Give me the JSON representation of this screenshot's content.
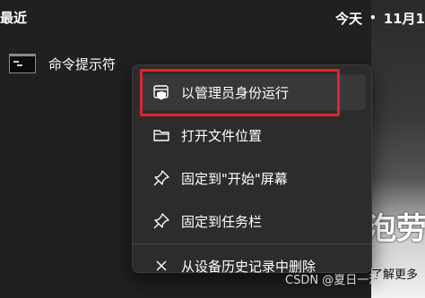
{
  "section": {
    "title": "最近"
  },
  "recent": [
    {
      "label": "命令提示符",
      "icon": "command-prompt-icon"
    }
  ],
  "header": {
    "date_prefix": "今天",
    "separator": "•",
    "date": "11月1"
  },
  "background": {
    "big_text": "泡劳征",
    "small_text": "了解更多"
  },
  "menu": {
    "items": [
      {
        "label": "以管理员身份运行",
        "icon": "shield-window-icon",
        "highlighted": true
      },
      {
        "label": "打开文件位置",
        "icon": "folder-icon"
      },
      {
        "label": "固定到\"开始\"屏幕",
        "icon": "pin-icon"
      },
      {
        "label": "固定到任务栏",
        "icon": "pin-icon"
      },
      {
        "label": "从设备历史记录中删除",
        "icon": "close-icon"
      }
    ]
  },
  "watermark": "CSDN @夏日一派",
  "colors": {
    "highlight_border": "#e0242e",
    "menu_bg": "#2c2c2c",
    "page_bg": "#202020"
  }
}
